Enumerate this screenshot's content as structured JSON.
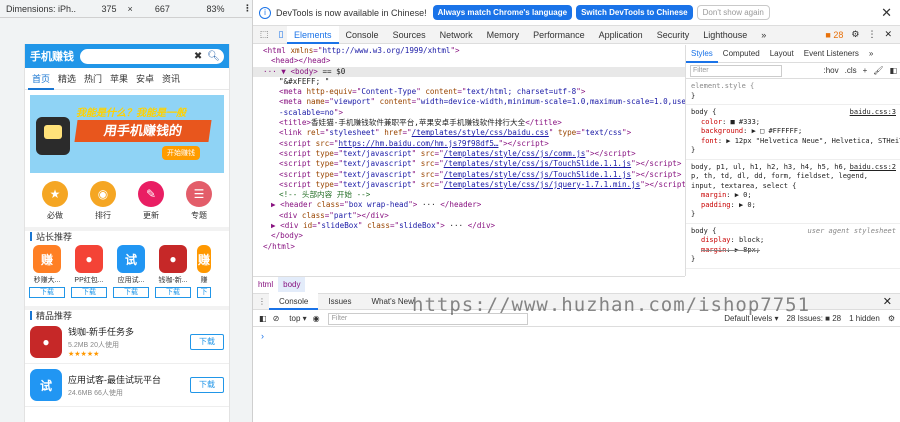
{
  "device_toolbar": {
    "dimensions_label": "Dimensions: iPh...",
    "width": "375",
    "height": "667",
    "zoom": "83%",
    "more_icon": "vertical-dots-icon"
  },
  "phone": {
    "logo": "手机赚钱",
    "nav_items": [
      "首页",
      "精选",
      "热门",
      "苹果",
      "安卓",
      "资讯"
    ],
    "banner": {
      "line1": "我能是什么？我能是一般",
      "headline": "用手机赚钱的",
      "button": "开始赚钱"
    },
    "categories": [
      {
        "label": "必做",
        "color": "#f5a623",
        "icon": "star-icon"
      },
      {
        "label": "排行",
        "color": "#f5a623",
        "icon": "ghost-icon"
      },
      {
        "label": "更新",
        "color": "#e91e63",
        "icon": "edit-icon"
      },
      {
        "label": "专题",
        "color": "#e35d6a",
        "icon": "list-icon"
      }
    ],
    "section1_title": "站长推荐",
    "apps": [
      {
        "name": "秒赚大...",
        "icon_text": "赚",
        "color": "#ff7f24",
        "download": "下载"
      },
      {
        "name": "PP红包...",
        "icon_text": "●",
        "color": "#f44336",
        "download": "下载"
      },
      {
        "name": "应用试...",
        "icon_text": "试",
        "color": "#2196f3",
        "download": "下载"
      },
      {
        "name": "钱咖-新...",
        "icon_text": "●",
        "color": "#c62828",
        "download": "下载"
      },
      {
        "name": "赚",
        "icon_text": "赚",
        "color": "#ff9800",
        "download": "下"
      }
    ],
    "section2_title": "精品推荐",
    "list": [
      {
        "name": "钱咖-新手任务多",
        "meta": "5.2MB  20人使用",
        "stars": "★★★★★",
        "icon_text": "●",
        "color": "#c62828",
        "download": "下载"
      },
      {
        "name": "应用试客-最佳试玩平台",
        "meta": "24.6MB  66人使用",
        "stars": "",
        "icon_text": "试",
        "color": "#2196f3",
        "download": "下载"
      }
    ]
  },
  "infobar": {
    "message": "DevTools is now available in Chinese!",
    "btn_match": "Always match Chrome's language",
    "btn_switch": "Switch DevTools to Chinese",
    "btn_dismiss": "Don't show again"
  },
  "devtools_tabs": [
    "Elements",
    "Console",
    "Sources",
    "Network",
    "Memory",
    "Performance",
    "Application",
    "Security",
    "Lighthouse"
  ],
  "devtools_issues_count": "28",
  "elements": {
    "lines": [
      {
        "indent": 0,
        "html": "<span class='tg'>&lt;html</span> <span class='an'>xmlns</span>=\"<span class='av'>http://www.w3.org/1999/xhtml</span>\"<span class='tg'>&gt;</span>"
      },
      {
        "indent": 1,
        "html": "<span class='tg'>&lt;head&gt;&lt;/head&gt;</span>"
      },
      {
        "indent": 0,
        "html": "··· ▼ <span class='tg'>&lt;body&gt;</span> <span class='tx'>== $0</span>",
        "sel": true
      },
      {
        "indent": 2,
        "html": "<span class='tx'>\"&amp;#xFEFF; \"</span>"
      },
      {
        "indent": 2,
        "html": "<span class='tg'>&lt;meta</span> <span class='an'>http-equiv</span>=\"<span class='av'>Content-Type</span>\" <span class='an'>content</span>=\"<span class='av'>text/html; charset=utf-8</span>\"<span class='tg'>&gt;</span>"
      },
      {
        "indent": 2,
        "html": "<span class='tg'>&lt;meta</span> <span class='an'>name</span>=\"<span class='av'>viewport</span>\" <span class='an'>content</span>=\"<span class='av'>width=device-width,minimum-scale=1.0,maximum-scale=1.0,user</span>"
      },
      {
        "indent": 2,
        "html": "<span class='av'>-scalable=no</span>\"<span class='tg'>&gt;</span>"
      },
      {
        "indent": 2,
        "html": "<span class='tg'>&lt;title&gt;</span><span class='tx'>香娃猫-手机赚钱软件兼职平台,苹果安卓手机赚钱软件排行大全</span><span class='tg'>&lt;/title&gt;</span>"
      },
      {
        "indent": 2,
        "html": "<span class='tg'>&lt;link</span> <span class='an'>rel</span>=\"<span class='av'>stylesheet</span>\" <span class='an'>href</span>=\"<span class='lk'>/templates/style/css/baidu.css</span>\" <span class='an'>type</span>=\"<span class='av'>text/css</span>\"<span class='tg'>&gt;</span>"
      },
      {
        "indent": 2,
        "html": "<span class='tg'>&lt;script</span> <span class='an'>src</span>=\"<span class='lk'>https://hm.baidu.com/hm.js?9f98df5…</span>\"<span class='tg'>&gt;&lt;/script&gt;</span>"
      },
      {
        "indent": 2,
        "html": "<span class='tg'>&lt;script</span> <span class='an'>type</span>=\"<span class='av'>text/javascript</span>\" <span class='an'>src</span>=\"<span class='lk'>/templates/style/css/js/comm.js</span>\"<span class='tg'>&gt;&lt;/script&gt;</span>"
      },
      {
        "indent": 2,
        "html": "<span class='tg'>&lt;script</span> <span class='an'>type</span>=\"<span class='av'>text/javascript</span>\" <span class='an'>src</span>=\"<span class='lk'>/templates/style/css/js/TouchSlide.1.1.js</span>\"<span class='tg'>&gt;&lt;/script&gt;</span>"
      },
      {
        "indent": 2,
        "html": "<span class='tg'>&lt;script</span> <span class='an'>type</span>=\"<span class='av'>text/javascript</span>\" <span class='an'>src</span>=\"<span class='lk'>/templates/style/css/js/TouchSlide.1.1.js</span>\"<span class='tg'>&gt;&lt;/script&gt;</span>"
      },
      {
        "indent": 2,
        "html": "<span class='tg'>&lt;script</span> <span class='an'>type</span>=\"<span class='av'>text/javascript</span>\" <span class='an'>src</span>=\"<span class='lk'>/templates/style/css/js/jquery-1.7.1.min.js</span>\"<span class='tg'>&gt;&lt;/script&gt;</span>"
      },
      {
        "indent": 2,
        "html": "<span class='cm'>&lt;!-- 头部内容 开始 --&gt;</span>"
      },
      {
        "indent": 1,
        "html": "▶ <span class='tg'>&lt;header</span> <span class='an'>class</span>=\"<span class='av'>box wrap-head</span>\"<span class='tg'>&gt;</span> <span class='tx'>···</span> <span class='tg'>&lt;/header&gt;</span>"
      },
      {
        "indent": 2,
        "html": "<span class='tg'>&lt;div</span> <span class='an'>class</span>=\"<span class='av'>part</span>\"<span class='tg'>&gt;&lt;/div&gt;</span>"
      },
      {
        "indent": 1,
        "html": "▶ <span class='tg'>&lt;div</span> <span class='an'>id</span>=\"<span class='av'>slideBox</span>\" <span class='an'>class</span>=\"<span class='av'>slideBox</span>\"<span class='tg'>&gt;</span> <span class='tx'>···</span> <span class='tg'>&lt;/div&gt;</span>"
      },
      {
        "indent": 1,
        "html": "<span class='tg'>&lt;/body&gt;</span>"
      },
      {
        "indent": 0,
        "html": "<span class='tg'>&lt;/html&gt;</span>"
      }
    ]
  },
  "breadcrumbs": [
    "html",
    "body"
  ],
  "styles_tabs": [
    "Styles",
    "Computed",
    "Layout",
    "Event Listeners"
  ],
  "styles_filter_placeholder": "Filter",
  "styles_tools": [
    ":hov",
    ".cls",
    "+"
  ],
  "style_rules": [
    {
      "selector": "element.style {",
      "source": "",
      "ua": false,
      "props": []
    },
    {
      "selector": "body {",
      "source": "baidu.css:3",
      "ua": false,
      "props": [
        {
          "name": "color",
          "value": "■ #333;"
        },
        {
          "name": "background",
          "value": "▶ □ #FFFFFF;"
        },
        {
          "name": "font",
          "value": "▶ 12px \"Helvetica Neue\", Helvetica, STHeiTi, sans-serif;"
        }
      ]
    },
    {
      "selector": "body, p1, ul, h1, h2, h3, h4, h5, h6, p, th, td, dl, dd, form, fieldset, legend, input, textarea, select {",
      "source": "baidu.css:2",
      "ua": false,
      "props": [
        {
          "name": "margin",
          "value": "▶ 0;"
        },
        {
          "name": "padding",
          "value": "▶ 0;"
        }
      ]
    },
    {
      "selector": "body {",
      "source": "user agent stylesheet",
      "ua": true,
      "props": [
        {
          "name": "display",
          "value": "block;",
          "strike": false
        },
        {
          "name": "margin",
          "value": "▶ 8px;",
          "strike": true
        }
      ]
    }
  ],
  "drawer_tabs": [
    "Console",
    "Issues",
    "What's New"
  ],
  "console": {
    "context": "top",
    "filter_placeholder": "Filter",
    "levels": "Default levels ▾",
    "issues": "28 Issues: ■ 28",
    "hidden": "1 hidden",
    "prompt": "›"
  },
  "watermark": "https://www.huzhan.com/ishop7751"
}
